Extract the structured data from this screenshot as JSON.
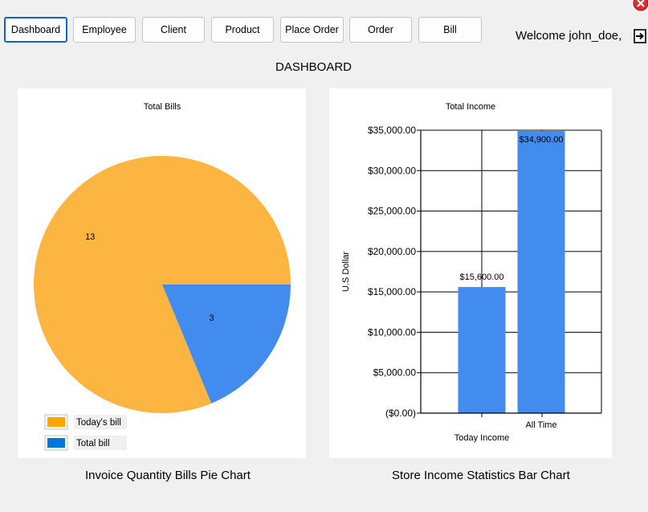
{
  "nav": {
    "buttons": [
      "Dashboard",
      "Employee",
      "Client",
      "Product",
      "Place Order",
      "Order",
      "Bill"
    ],
    "active": "Dashboard"
  },
  "header": {
    "welcome": "Welcome john_doe,",
    "logout_icon": "logout-icon",
    "close_icon": "close-icon"
  },
  "page_title": "DASHBOARD",
  "captions": {
    "pie": "Invoice Quantity Bills Pie Chart",
    "bar": "Store Income Statistics Bar Chart"
  },
  "colors": {
    "pie_today": "#fbb540",
    "pie_total": "#428cf0",
    "legend_today": "#ffa500",
    "legend_total": "#0078d7",
    "bar": "#428cf0"
  },
  "chart_data": [
    {
      "type": "pie",
      "title": "Total Bills",
      "labels": [
        "Today's bill",
        "Total bill"
      ],
      "values": [
        13,
        3
      ],
      "legend": "bottom-left"
    },
    {
      "type": "bar",
      "title": "Total Income",
      "ylabel": "U.S Dollar",
      "categories": [
        "Today Income",
        "All Time"
      ],
      "values": [
        15600,
        34900
      ],
      "value_labels": [
        "$15,600.00",
        "$34,900.00"
      ],
      "ylim": [
        0,
        35000
      ],
      "yticks": [
        "($0.00)",
        "$5,000.00",
        "$10,000.00",
        "$15,000.00",
        "$20,000.00",
        "$25,000.00",
        "$30,000.00",
        "$35,000.00"
      ],
      "grid": true
    }
  ]
}
